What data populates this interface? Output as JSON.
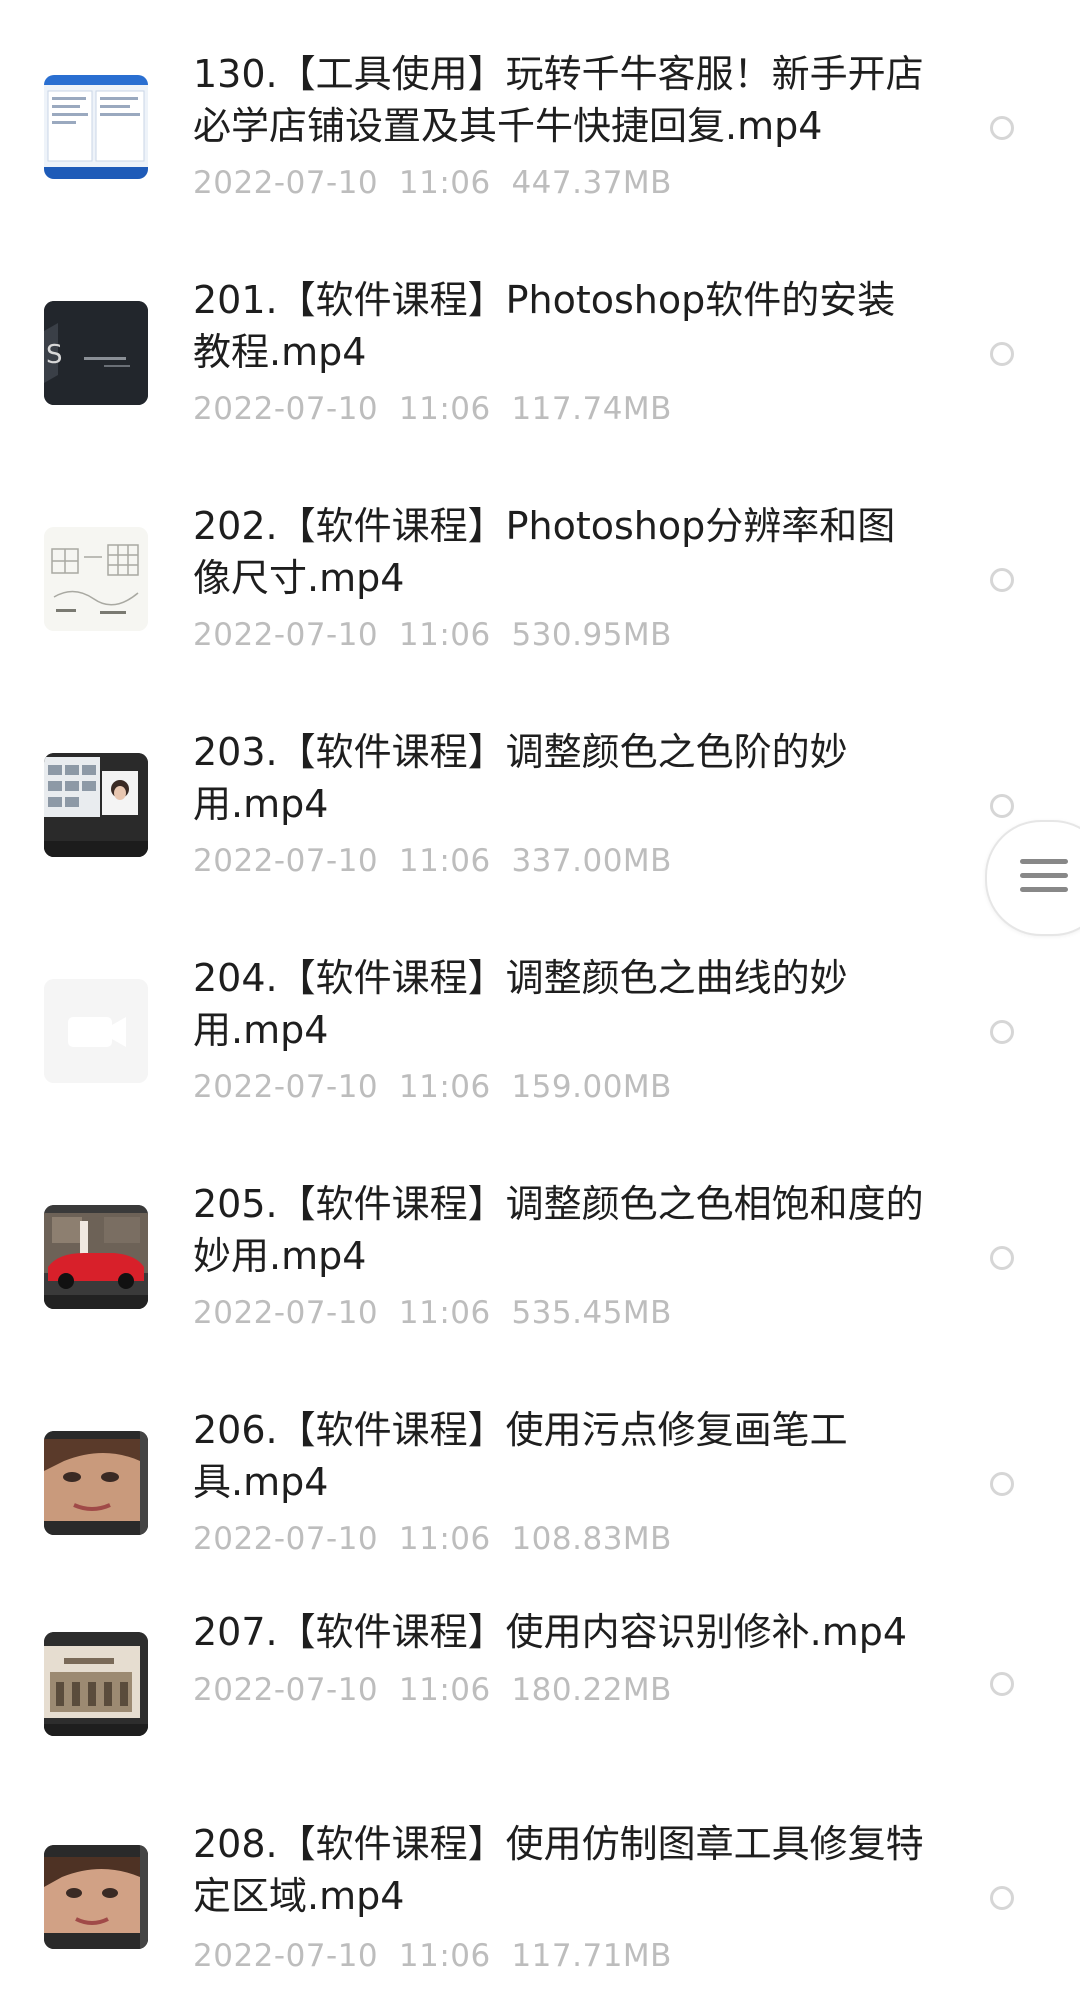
{
  "files": [
    {
      "title": "130.【工具使用】玩转千牛客服！新手开店必学店铺设置及其千牛快捷回复.mp4",
      "date": "2022-07-10",
      "time": "11:06",
      "size": "447.37MB",
      "thumb_icon": "screenshot-thumbnail"
    },
    {
      "title": "201.【软件课程】Photoshop软件的安装教程.mp4",
      "date": "2022-07-10",
      "time": "11:06",
      "size": "117.74MB",
      "thumb_icon": "dark-title-slide-thumbnail"
    },
    {
      "title": "202.【软件课程】Photoshop分辨率和图像尺寸.mp4",
      "date": "2022-07-10",
      "time": "11:06",
      "size": "530.95MB",
      "thumb_icon": "sketch-thumbnail"
    },
    {
      "title": "203.【软件课程】调整颜色之色阶的妙用.mp4",
      "date": "2022-07-10",
      "time": "11:06",
      "size": "337.00MB",
      "thumb_icon": "photoshop-window-thumbnail"
    },
    {
      "title": "204.【软件课程】调整颜色之曲线的妙用.mp4",
      "date": "2022-07-10",
      "time": "11:06",
      "size": "159.00MB",
      "thumb_icon": "video-placeholder-icon"
    },
    {
      "title": "205.【软件课程】调整颜色之色相饱和度的妙用.mp4",
      "date": "2022-07-10",
      "time": "11:06",
      "size": "535.45MB",
      "thumb_icon": "red-car-thumbnail"
    },
    {
      "title": "206.【软件课程】使用污点修复画笔工具.mp4",
      "date": "2022-07-10",
      "time": "11:06",
      "size": "108.83MB",
      "thumb_icon": "portrait-thumbnail"
    },
    {
      "title": "207.【软件课程】使用内容识别修补.mp4",
      "date": "2022-07-10",
      "time": "11:06",
      "size": "180.22MB",
      "thumb_icon": "building-thumbnail"
    },
    {
      "title": "208.【软件课程】使用仿制图章工具修复特定区域.mp4",
      "date": "2022-07-10",
      "time": "11:06",
      "size": "117.71MB",
      "thumb_icon": "portrait-thumbnail"
    }
  ],
  "side_handle_icon": "menu-lines-icon"
}
